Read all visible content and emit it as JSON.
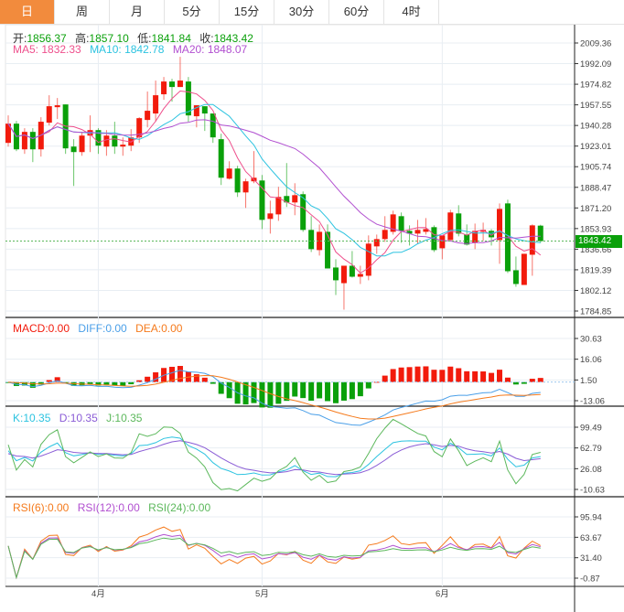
{
  "tabs": [
    {
      "label": "日",
      "active": true
    },
    {
      "label": "周"
    },
    {
      "label": "月"
    },
    {
      "label": "5分"
    },
    {
      "label": "15分"
    },
    {
      "label": "30分"
    },
    {
      "label": "60分"
    },
    {
      "label": "4时"
    }
  ],
  "ohlc_legend": {
    "open_label": "开:",
    "open": "1856.37",
    "high_label": "高:",
    "high": "1857.10",
    "low_label": "低:",
    "low": "1841.84",
    "close_label": "收:",
    "close": "1843.42"
  },
  "ma_legend": {
    "ma5": "MA5: 1832.33",
    "ma10": "MA10: 1842.78",
    "ma20": "MA20: 1848.07"
  },
  "macd_legend": {
    "macd": "MACD:0.00",
    "diff": "DIFF:0.00",
    "dea": "DEA:0.00"
  },
  "kdj_legend": {
    "k": "K:10.35",
    "d": "D:10.35",
    "j": "J:10.35"
  },
  "rsi_legend": {
    "rsi6": "RSI(6):0.00",
    "rsi12": "RSI(12):0.00",
    "rsi24": "RSI(24):0.00"
  },
  "current_price": "1843.42",
  "colors": {
    "up": "#f21b0c",
    "down": "#0aa00a",
    "ma5": "#ee4f8c",
    "ma10": "#2cc3e0",
    "ma20": "#b14fd0",
    "diff": "#4a9fe8",
    "dea": "#f57a1c",
    "k": "#2cc3e0",
    "d": "#8a5cd6",
    "j": "#5cb85c",
    "rsi6": "#f57a1c",
    "rsi12": "#b14fd0",
    "rsi24": "#5cb85c",
    "tab_active": "#f28b3d"
  },
  "chart_data": {
    "type": "candlestick",
    "price_axis": {
      "ticks": [
        "2009.36",
        "1992.09",
        "1974.82",
        "1957.55",
        "1940.28",
        "1923.01",
        "1905.74",
        "1888.47",
        "1871.20",
        "1853.93",
        "1836.66",
        "1819.39",
        "1802.12",
        "1784.85"
      ],
      "range": [
        1784.85,
        2009.36
      ]
    },
    "macd_axis": {
      "ticks": [
        "30.63",
        "16.06",
        "1.50",
        "-13.06"
      ],
      "range": [
        -13.06,
        30.63
      ]
    },
    "kdj_axis": {
      "ticks": [
        "99.49",
        "62.79",
        "26.08",
        "-10.63"
      ],
      "range": [
        -10.63,
        99.49
      ]
    },
    "rsi_axis": {
      "ticks": [
        "95.94",
        "63.67",
        "31.40",
        "-0.87"
      ],
      "range": [
        -0.87,
        95.94
      ]
    },
    "x_labels": [
      {
        "label": "4月",
        "index": 11
      },
      {
        "label": "5月",
        "index": 31
      },
      {
        "label": "6月",
        "index": 53
      }
    ],
    "candles": [
      [
        1925.7,
        1948.7,
        1922.6,
        1941.8
      ],
      [
        1941.8,
        1944.1,
        1918.8,
        1920.3
      ],
      [
        1920.3,
        1938.0,
        1916.5,
        1934.9
      ],
      [
        1934.9,
        1938.0,
        1909.6,
        1920.3
      ],
      [
        1920.3,
        1947.2,
        1914.2,
        1943.4
      ],
      [
        1942.6,
        1965.6,
        1940.3,
        1956.4
      ],
      [
        1955.6,
        1963.3,
        1945.7,
        1957.2
      ],
      [
        1957.9,
        1957.9,
        1916.5,
        1921.1
      ],
      [
        1922.6,
        1928.8,
        1889.6,
        1918.0
      ],
      [
        1918.0,
        1934.9,
        1914.9,
        1931.8
      ],
      [
        1931.8,
        1948.7,
        1918.0,
        1936.4
      ],
      [
        1936.4,
        1938.0,
        1916.5,
        1923.4
      ],
      [
        1922.6,
        1936.4,
        1914.9,
        1931.8
      ],
      [
        1931.8,
        1943.4,
        1916.5,
        1922.6
      ],
      [
        1922.6,
        1930.3,
        1914.9,
        1924.2
      ],
      [
        1923.4,
        1937.2,
        1918.8,
        1930.3
      ],
      [
        1930.3,
        1947.2,
        1925.7,
        1946.4
      ],
      [
        1944.9,
        1968.7,
        1938.7,
        1952.6
      ],
      [
        1950.3,
        1977.9,
        1943.4,
        1965.6
      ],
      [
        1966.4,
        1980.9,
        1961.8,
        1977.1
      ],
      [
        1977.1,
        1979.4,
        1960.2,
        1972.5
      ],
      [
        1972.5,
        1997.8,
        1972.5,
        1977.9
      ],
      [
        1977.1,
        1980.9,
        1943.4,
        1948.7
      ],
      [
        1948.0,
        1957.2,
        1938.7,
        1957.2
      ],
      [
        1956.4,
        1956.4,
        1935.7,
        1950.3
      ],
      [
        1950.3,
        1950.3,
        1925.7,
        1930.3
      ],
      [
        1928.8,
        1933.4,
        1890.4,
        1896.5
      ],
      [
        1895.7,
        1910.3,
        1895.0,
        1904.2
      ],
      [
        1904.2,
        1906.5,
        1880.4,
        1884.2
      ],
      [
        1884.2,
        1895.7,
        1871.2,
        1893.5
      ],
      [
        1893.5,
        1918.8,
        1891.9,
        1896.5
      ],
      [
        1894.2,
        1898.8,
        1853.5,
        1861.2
      ],
      [
        1862.0,
        1877.3,
        1849.7,
        1866.6
      ],
      [
        1865.8,
        1888.9,
        1860.4,
        1880.4
      ],
      [
        1881.2,
        1908.8,
        1872.0,
        1875.8
      ],
      [
        1875.8,
        1891.9,
        1865.1,
        1881.9
      ],
      [
        1882.7,
        1885.0,
        1851.2,
        1852.8
      ],
      [
        1852.8,
        1864.3,
        1834.3,
        1836.7
      ],
      [
        1835.9,
        1857.4,
        1831.3,
        1851.2
      ],
      [
        1851.2,
        1857.4,
        1820.5,
        1820.5
      ],
      [
        1821.3,
        1828.2,
        1798.3,
        1810.6
      ],
      [
        1808.2,
        1822.8,
        1786.0,
        1822.8
      ],
      [
        1822.8,
        1835.1,
        1812.9,
        1813.6
      ],
      [
        1813.6,
        1822.8,
        1807.5,
        1815.9
      ],
      [
        1814.4,
        1848.2,
        1810.6,
        1841.3
      ],
      [
        1839.0,
        1848.9,
        1832.8,
        1845.1
      ],
      [
        1845.1,
        1864.3,
        1842.8,
        1852.8
      ],
      [
        1851.2,
        1868.9,
        1848.9,
        1865.8
      ],
      [
        1864.3,
        1867.4,
        1842.0,
        1852.0
      ],
      [
        1852.0,
        1856.6,
        1839.7,
        1849.7
      ],
      [
        1849.7,
        1861.2,
        1841.3,
        1852.8
      ],
      [
        1851.2,
        1862.7,
        1848.9,
        1853.5
      ],
      [
        1855.1,
        1856.6,
        1834.3,
        1835.9
      ],
      [
        1837.4,
        1848.2,
        1828.2,
        1848.2
      ],
      [
        1844.3,
        1869.6,
        1844.3,
        1867.4
      ],
      [
        1866.6,
        1873.5,
        1847.4,
        1849.7
      ],
      [
        1848.9,
        1857.4,
        1839.7,
        1840.5
      ],
      [
        1842.0,
        1858.1,
        1836.7,
        1852.0
      ],
      [
        1851.2,
        1858.9,
        1843.6,
        1852.8
      ],
      [
        1852.0,
        1853.5,
        1839.7,
        1846.6
      ],
      [
        1844.3,
        1875.0,
        1824.4,
        1870.4
      ],
      [
        1875.0,
        1878.1,
        1816.7,
        1818.2
      ],
      [
        1819.0,
        1830.5,
        1805.2,
        1807.5
      ],
      [
        1806.7,
        1832.8,
        1806.7,
        1832.8
      ],
      [
        1832.0,
        1857.4,
        1814.4,
        1856.6
      ],
      [
        1856.37,
        1857.1,
        1841.84,
        1843.42
      ]
    ]
  }
}
